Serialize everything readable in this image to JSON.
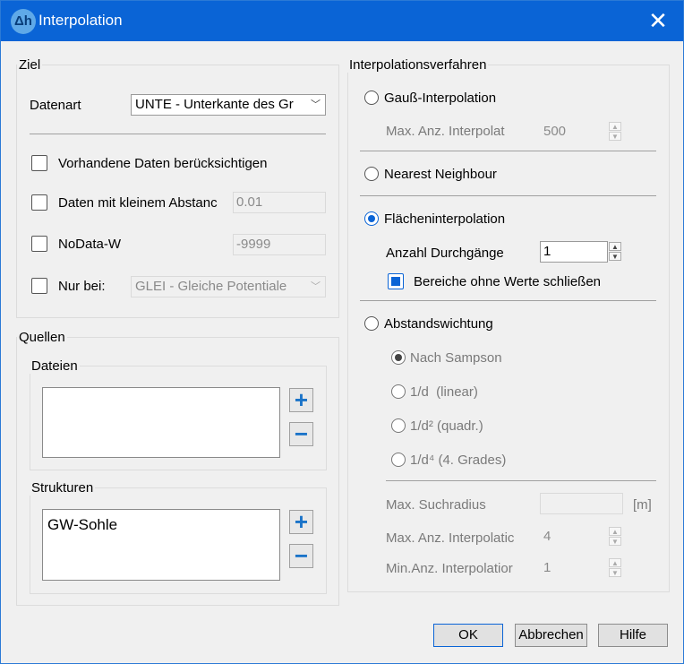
{
  "window": {
    "title": "Interpolation",
    "app_icon_text": "Δh",
    "close_glyph": "✕",
    "accent": "#0a64d6"
  },
  "ziel": {
    "group_label": "Ziel",
    "datenart_label": "Datenart",
    "datenart_value": "UNTE - Unterkante des Gr",
    "vorhandene_label": "Vorhandene Daten berücksichtigen",
    "vorhandene_checked": false,
    "abstand_label": "Daten mit kleinem Abstanc",
    "abstand_checked": false,
    "abstand_value": "0.01",
    "nodata_label": "NoData-W",
    "nodata_checked": false,
    "nodata_value": "-9999",
    "nurbei_label": "Nur bei:",
    "nurbei_checked": false,
    "nurbei_value": "GLEI - Gleiche Potentiale"
  },
  "quellen": {
    "group_label": "Quellen",
    "dateien_label": "Dateien",
    "dateien_items": [],
    "strukturen_label": "Strukturen",
    "strukturen_items": [
      "GW-Sohle"
    ],
    "add_glyph": "+",
    "remove_glyph": "−"
  },
  "verfahren": {
    "group_label": "Interpolationsverfahren",
    "gauss_label": "Gauß-Interpolation",
    "gauss_selected": false,
    "gauss_max_label": "Max. Anz. Interpolat",
    "gauss_max_value": "500",
    "nearest_label": "Nearest Neighbour",
    "nearest_selected": false,
    "flaechen_label": "Flächeninterpolation",
    "flaechen_selected": true,
    "durchgaenge_label": "Anzahl Durchgänge",
    "durchgaenge_value": "1",
    "bereiche_label": "Bereiche ohne Werte schließen",
    "bereiche_checked": true,
    "abstand_label": "Abstandswichtung",
    "abstand_selected": false,
    "sub_options": [
      {
        "label": "Nach Sampson",
        "selected": true
      },
      {
        "label": "1/d  (linear)",
        "selected": false
      },
      {
        "label": "1/d² (quadr.)",
        "selected": false
      },
      {
        "label": "1/d⁴ (4. Grades)",
        "selected": false
      }
    ],
    "suchradius_label": "Max. Suchradius",
    "suchradius_value": "",
    "suchradius_unit": "[m]",
    "max_interp_label": "Max. Anz. Interpolatic",
    "max_interp_value": "4",
    "min_interp_label": "Min.Anz. Interpolatior",
    "min_interp_value": "1"
  },
  "buttons": {
    "ok": "OK",
    "abbrechen": "Abbrechen",
    "hilfe": "Hilfe"
  },
  "spin_up_glyph": "▲",
  "spin_down_glyph": "▼",
  "dropdown_glyph": "﹀"
}
